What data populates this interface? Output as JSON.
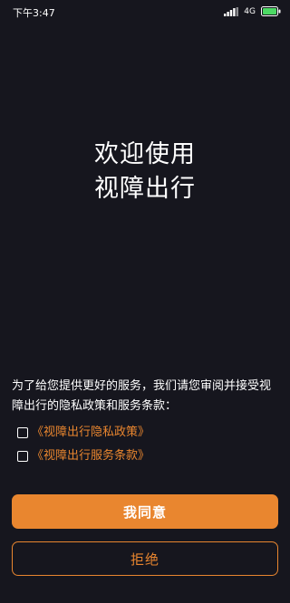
{
  "status_bar": {
    "time": "下午3:47",
    "network": "4G",
    "icons": [
      "signal-icon",
      "battery-icon"
    ]
  },
  "welcome": {
    "line1": "欢迎使用",
    "line2": "视障出行"
  },
  "consent": {
    "text": "为了给您提供更好的服务，我们请您审阅并接受视障出行的隐私政策和服务条款："
  },
  "agreements": [
    {
      "label": "《视障出行隐私政策》",
      "checked": false
    },
    {
      "label": "《视障出行服务条款》",
      "checked": false
    }
  ],
  "actions": {
    "agree_label": "我同意",
    "reject_label": "拒绝"
  },
  "colors": {
    "background": "#16161e",
    "accent": "#e9862f",
    "text": "#ffffff"
  }
}
